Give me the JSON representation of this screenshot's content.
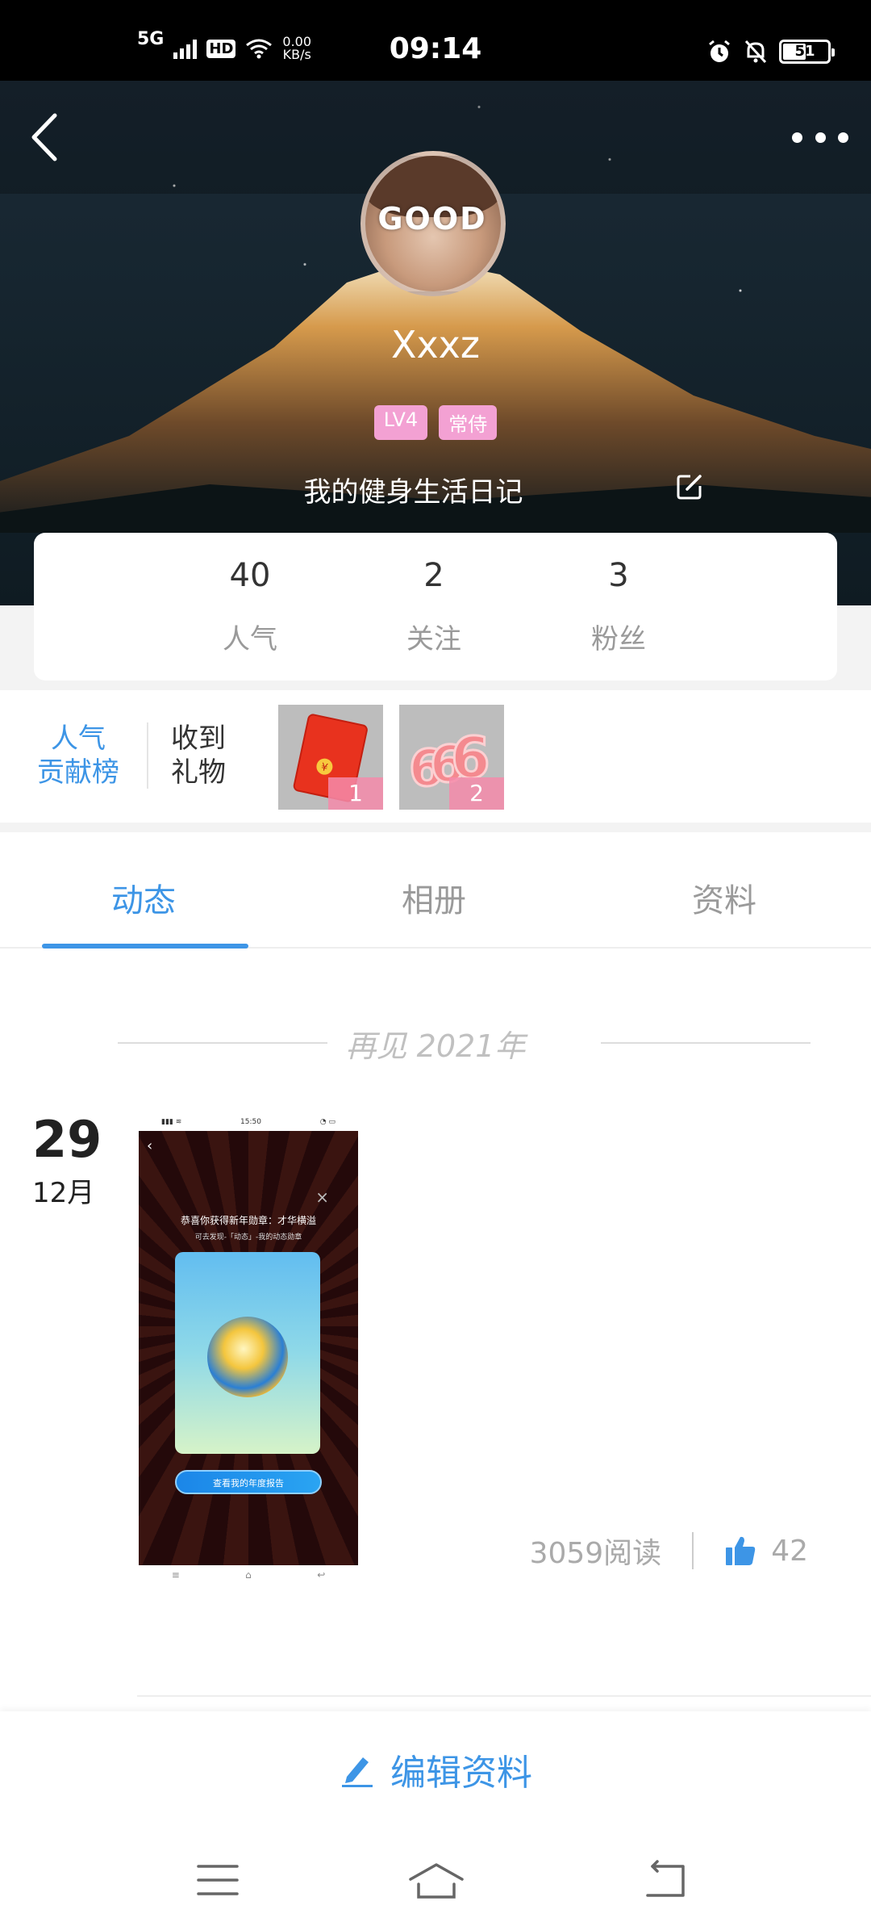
{
  "status_bar": {
    "network": "5G",
    "hd": "HD",
    "speed_value": "0.00",
    "speed_unit": "KB/s",
    "time": "09:14",
    "battery": "51"
  },
  "profile": {
    "username": "Xxxz",
    "avatar_text": "GOOD",
    "badges": [
      "LV4",
      "常侍"
    ],
    "bio": "我的健身生活日记"
  },
  "stats": [
    {
      "value": "40",
      "label": "人气"
    },
    {
      "value": "2",
      "label": "关注"
    },
    {
      "value": "3",
      "label": "粉丝"
    }
  ],
  "gifts": {
    "rank_label_line1": "人气",
    "rank_label_line2": "贡献榜",
    "received_line1": "收到",
    "received_line2": "礼物",
    "items": [
      {
        "name": "red-envelope",
        "count": "1"
      },
      {
        "name": "666",
        "count": "2"
      }
    ]
  },
  "tabs": [
    "动态",
    "相册",
    "资料"
  ],
  "active_tab": "动态",
  "feed": {
    "year_separator": "再见 2021年",
    "post": {
      "day": "29",
      "month": "12月",
      "thumbnail": {
        "status_time": "15:50",
        "title": "恭喜你获得新年勋章：才华横溢",
        "subtitle": "可去发现-「动态」-我的动态勋章",
        "cta": "查看我的年度报告"
      },
      "reads": "3059阅读",
      "likes": "42"
    }
  },
  "edit_profile_label": "编辑资料",
  "colors": {
    "accent": "#3d95e6",
    "badge_pink": "#f3a1d3"
  }
}
